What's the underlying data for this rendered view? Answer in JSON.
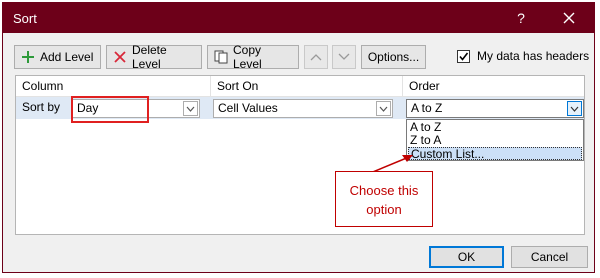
{
  "dialog": {
    "title": "Sort",
    "help": "?"
  },
  "toolbar": {
    "add_level": "Add Level",
    "delete_level": "Delete Level",
    "copy_level": "Copy Level",
    "options": "Options...",
    "headers_checkbox_label": "My data has headers",
    "headers_checked": true
  },
  "grid": {
    "columns": [
      "Column",
      "Sort On",
      "Order"
    ],
    "row": {
      "label": "Sort by",
      "column_value": "Day",
      "sort_on_value": "Cell Values",
      "order_value": "A to Z"
    }
  },
  "order_dropdown": {
    "options": [
      "A to Z",
      "Z to A",
      "Custom List..."
    ],
    "selected": "Custom List..."
  },
  "annotation": {
    "text": "Choose this option",
    "color": "#c00000"
  },
  "buttons": {
    "ok": "OK",
    "cancel": "Cancel"
  },
  "colors": {
    "titlebar": "#6d0019",
    "highlight": "#e02020",
    "selection": "#cce0f7"
  }
}
